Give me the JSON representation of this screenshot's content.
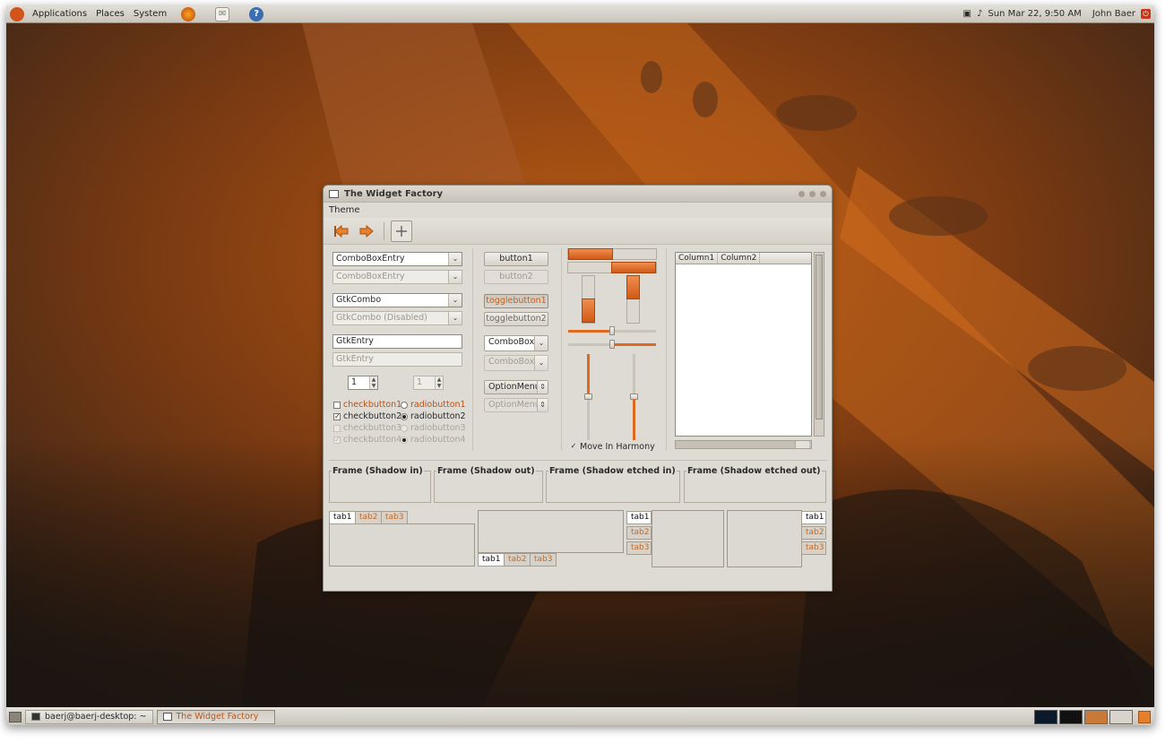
{
  "top_panel": {
    "menus": [
      "Applications",
      "Places",
      "System"
    ],
    "launchers": [
      "firefox-icon",
      "mail-icon",
      "help-icon"
    ],
    "clock": "Sun Mar 22,  9:50 AM",
    "user": "John Baer"
  },
  "window": {
    "title": "The Widget Factory",
    "menu": "Theme"
  },
  "col1": {
    "combobox_entry": "ComboBoxEntry",
    "combobox_entry_disabled": "ComboBoxEntry",
    "gtkcombo": "GtkCombo",
    "gtkcombo_disabled": "GtkCombo (Disabled)",
    "entry": "GtkEntry",
    "entry_disabled": "GtkEntry",
    "spin1": "1",
    "spin2": "1",
    "checks": [
      "checkbutton1",
      "checkbutton2",
      "checkbutton3",
      "checkbutton4"
    ],
    "radios": [
      "radiobutton1",
      "radiobutton2",
      "radiobutton3",
      "radiobutton4"
    ]
  },
  "col2": {
    "button1": "button1",
    "button2": "button2",
    "toggle1": "togglebutton1",
    "toggle2": "togglebutton2",
    "combobox": "ComboBox",
    "combobox_disabled": "ComboBox",
    "optionmenu": "OptionMenu",
    "optionmenu_disabled": "OptionMenu"
  },
  "col3": {
    "progress_h1": 0.5,
    "progress_h2": 0.5,
    "progress_v1": 0.5,
    "progress_v2": 0.5,
    "move_in_harmony": "Move In Harmony"
  },
  "tree": {
    "columns": [
      "Column1",
      "Column2"
    ]
  },
  "frames": [
    "Frame (Shadow in)",
    "Frame (Shadow out)",
    "Frame (Shadow etched in)",
    "Frame (Shadow etched out)"
  ],
  "tabs": [
    "tab1",
    "tab2",
    "tab3"
  ],
  "taskbar": {
    "items": [
      "baerj@baerj-desktop: ~",
      "The Widget Factory"
    ]
  },
  "colors": {
    "accent": "#d9641e",
    "panel": "#d6d2ca"
  }
}
